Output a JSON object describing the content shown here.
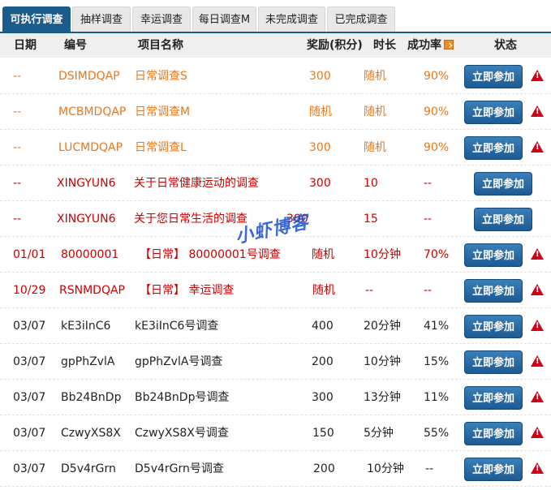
{
  "tabs": [
    {
      "label": "可执行调查",
      "active": true
    },
    {
      "label": "抽样调查",
      "active": false
    },
    {
      "label": "幸运调查",
      "active": false
    },
    {
      "label": "每日调查M",
      "active": false
    },
    {
      "label": "未完成调查",
      "active": false
    },
    {
      "label": "已完成调查",
      "active": false
    }
  ],
  "headers": {
    "date": "日期",
    "code": "编号",
    "name": "项目名称",
    "reward": "奖励(积分)",
    "duration": "时长",
    "rate": "成功率",
    "status": "状态"
  },
  "watermark": "小虾博客",
  "button_label": "立即参加",
  "colors": {
    "orange": "#e8781e",
    "red": "#cc0000",
    "normal": "#222222",
    "accent": "#1a5c8c"
  },
  "rows": [
    {
      "style": "orange",
      "date": "--",
      "code": "DSIMDQAP",
      "name": "日常调查S",
      "reward": "300",
      "duration": "随机",
      "rate": "90%",
      "warn": true
    },
    {
      "style": "orange",
      "date": "--",
      "code": "MCBMDQAP",
      "name": "日常调查M",
      "reward": "随机",
      "duration": "随机",
      "rate": "90%",
      "warn": true
    },
    {
      "style": "orange",
      "date": "--",
      "code": "LUCMDQAP",
      "name": "日常调查L",
      "reward": "300",
      "duration": "随机",
      "rate": "90%",
      "warn": true
    },
    {
      "style": "red",
      "date": "--",
      "code": "XINGYUN6",
      "name": "关于日常健康运动的调查",
      "reward": "300",
      "duration": "10",
      "rate": "--",
      "warn": false
    },
    {
      "style": "red",
      "date": "--",
      "code": "XINGYUN6",
      "name": "关于您日常生活的调查",
      "reward": "300",
      "duration": "15",
      "rate": "--",
      "warn": false
    },
    {
      "style": "red",
      "date": "01/01",
      "code": "80000001",
      "name": "【日常】 80000001号调查",
      "reward": "随机",
      "duration": "10分钟",
      "rate": "70%",
      "warn": true
    },
    {
      "style": "red",
      "date": "10/29",
      "code": "RSNMDQAP",
      "name": "【日常】 幸运调查",
      "reward": "随机",
      "duration": "--",
      "rate": "--",
      "warn": true
    },
    {
      "style": "normal",
      "date": "03/07",
      "code": "kE3iInC6",
      "name": "kE3iInC6号调查",
      "reward": "400",
      "duration": "20分钟",
      "rate": "41%",
      "warn": true
    },
    {
      "style": "normal",
      "date": "03/07",
      "code": "gpPhZvlA",
      "name": "gpPhZvlA号调查",
      "reward": "200",
      "duration": "10分钟",
      "rate": "15%",
      "warn": true
    },
    {
      "style": "normal",
      "date": "03/07",
      "code": "Bb24BnDp",
      "name": "Bb24BnDp号调查",
      "reward": "300",
      "duration": "13分钟",
      "rate": "11%",
      "warn": true
    },
    {
      "style": "normal",
      "date": "03/07",
      "code": "CzwyXS8X",
      "name": "CzwyXS8X号调查",
      "reward": "150",
      "duration": "5分钟",
      "rate": "55%",
      "warn": true
    },
    {
      "style": "normal",
      "date": "03/07",
      "code": "D5v4rGrn",
      "name": "D5v4rGrn号调查",
      "reward": "200",
      "duration": "10分钟",
      "rate": "--",
      "warn": true
    }
  ]
}
